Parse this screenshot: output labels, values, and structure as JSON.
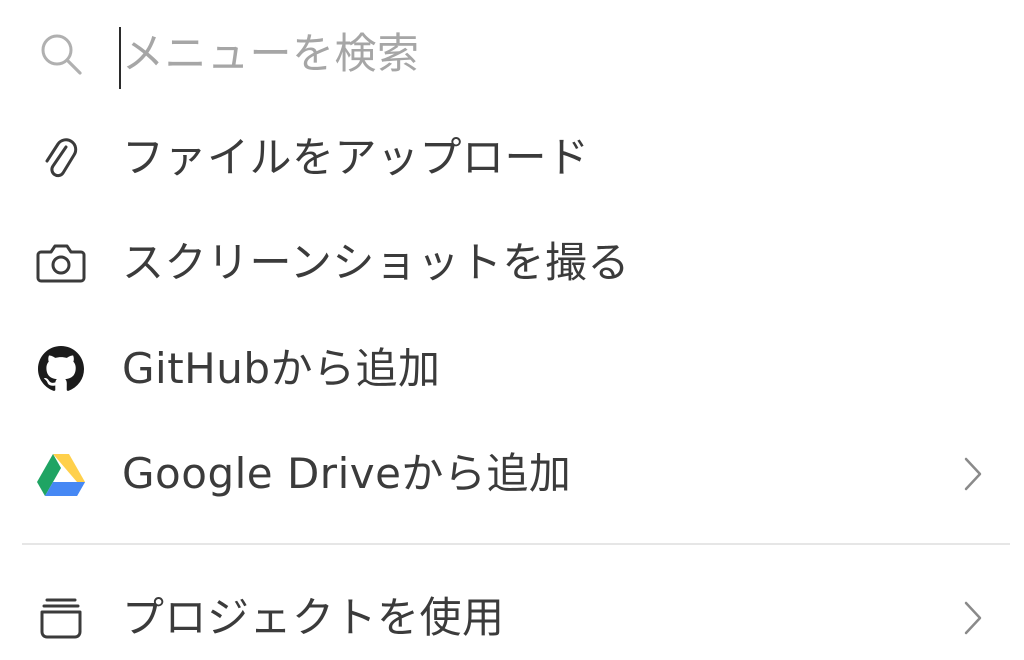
{
  "search": {
    "placeholder": "メニューを検索",
    "icon": "search-icon"
  },
  "items": [
    {
      "label": "ファイルをアップロード",
      "icon": "paperclip-icon",
      "has_submenu": false
    },
    {
      "label": "スクリーンショットを撮る",
      "icon": "camera-icon",
      "has_submenu": false
    },
    {
      "label": "GitHubから追加",
      "icon": "github-icon",
      "has_submenu": false
    },
    {
      "label": "Google Driveから追加",
      "icon": "google-drive-icon",
      "has_submenu": true
    },
    {
      "label": "プロジェクトを使用",
      "icon": "project-box-icon",
      "has_submenu": true
    }
  ],
  "colors": {
    "text": "#3b3b3b",
    "placeholder": "#a6a6a6",
    "divider": "#e6e6e6",
    "drive_green": "#1fa463",
    "drive_yellow": "#ffd04b",
    "drive_blue": "#4688f4",
    "drive_red": "#db4437"
  }
}
